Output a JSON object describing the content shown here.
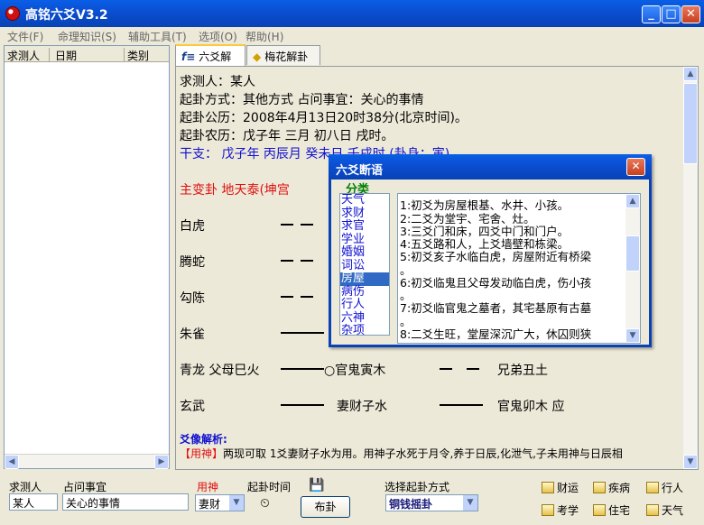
{
  "window": {
    "title": "高铭六爻V3.2",
    "min": "_",
    "max": "□",
    "close": "✕"
  },
  "menu": [
    "文件(F)",
    "命理知识(S)",
    "辅助工具(T)",
    "选项(O)",
    "帮助(H)"
  ],
  "list": {
    "headers": [
      "求测人",
      "日期",
      "类别"
    ]
  },
  "tabs": [
    {
      "icon": "f≡",
      "label": "六爻解卦"
    },
    {
      "icon": "◆",
      "label": "梅花解卦"
    }
  ],
  "content": {
    "line1": "求测人：某人",
    "line2": "起卦方式：其他方式     占问事宜：关心的事情",
    "line3": "起卦公历：2008年4月13日20时38分(北京时间)。",
    "line4": "起卦农历：戊子年 三月 初八日 戌时。",
    "line5": "干支：   戊子年   丙辰月   癸未日   壬戌时   (卦身：寅)",
    "line6": "主变卦     地天泰(坤宫",
    "rows": [
      {
        "label": "白虎"
      },
      {
        "label": "腾蛇"
      },
      {
        "label": "勾陈"
      },
      {
        "label": "朱雀"
      },
      {
        "label": "青龙 父母巳火",
        "mid": "○官鬼寅木",
        "right": "兄弟丑土"
      },
      {
        "label": "玄武",
        "mid": "妻财子水",
        "right": "官鬼卯木 应"
      }
    ],
    "analysis_title": "爻像解析:",
    "analysis_tag": "【用神】",
    "analysis_text": "两现可取 1爻妻财子水为用。用神子水死于月令,养于日辰,化泄气,子未用神与日辰相"
  },
  "dialog": {
    "title": "六爻断语",
    "category_label": "分类",
    "categories": [
      "天气",
      "求财",
      "求官",
      "学业",
      "婚姻",
      "词讼",
      "房屋",
      "病伤",
      "行人",
      "六神",
      "杂项"
    ],
    "selected": "房屋",
    "lines": [
      "1:初爻为房屋根基、水井、小孩。",
      "2:二爻为堂宇、宅舍、灶。",
      "3:三爻门和床，四爻中门和门户。",
      "4:五爻路和人，上爻墙壁和栋梁。",
      "5:初爻亥子水临白虎，房屋附近有桥梁",
      "。",
      "6:初爻临鬼且父母发动临白虎，伤小孩",
      "。",
      "7:初爻临官鬼之墓者，其宅基原有古墓",
      "。",
      "8:二爻生旺，堂屋深沉广大，休囚则狭"
    ]
  },
  "bottom": {
    "asker_label": "求测人",
    "asker_value": "某人",
    "matter_label": "占问事宜",
    "matter_value": "关心的事情",
    "yongshen_label": "用神",
    "yongshen_value": "妻财",
    "time_label": "起卦时间",
    "method_label": "选择起卦方式",
    "method_value": "铜钱摇卦",
    "cast_button": "布卦",
    "quick": [
      "财运",
      "疾病",
      "行人",
      "考学",
      "住宅",
      "天气"
    ]
  },
  "colors": {
    "title_blue": "#0b4fd3",
    "blue_text": "#1010d0",
    "red_text": "#e01010",
    "green_text": "#008000"
  }
}
